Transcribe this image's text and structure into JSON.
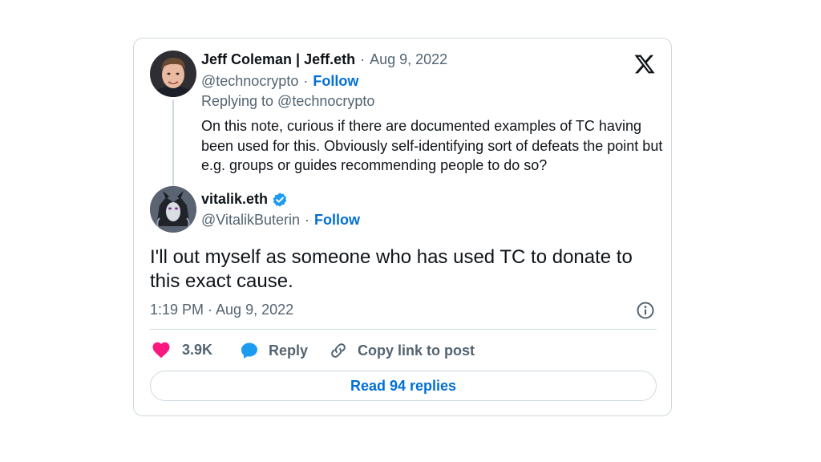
{
  "parent_tweet": {
    "author_name": "Jeff Coleman | Jeff.eth",
    "separator": "·",
    "date": "Aug 9, 2022",
    "handle": "@technocrypto",
    "follow_label": "Follow",
    "replying_to": "Replying to @technocrypto",
    "text": "On this note, curious if there are documented examples of TC having been used for this. Obviously self-identifying sort of defeats the point but e.g. groups or guides recommending people to do so?"
  },
  "main_tweet": {
    "author_name": "vitalik.eth",
    "verified": true,
    "handle": "@VitalikButerin",
    "separator": "·",
    "follow_label": "Follow",
    "text": "I'll out myself as someone who has used TC to donate to this exact cause.",
    "timestamp": "1:19 PM · Aug 9, 2022"
  },
  "actions": {
    "like_count": "3.9K",
    "reply_label": "Reply",
    "copy_link_label": "Copy link to post"
  },
  "read_replies_label": "Read 94 replies",
  "icons": {
    "logo": "x-logo-icon",
    "info": "info-icon",
    "like": "heart-icon",
    "reply": "speech-bubble-icon",
    "copy": "link-icon",
    "verified": "verified-badge-icon"
  },
  "colors": {
    "accent": "#006fd6",
    "like": "#f91880",
    "reply": "#1d9bf0",
    "muted": "#536471",
    "border": "#cfd9de"
  }
}
